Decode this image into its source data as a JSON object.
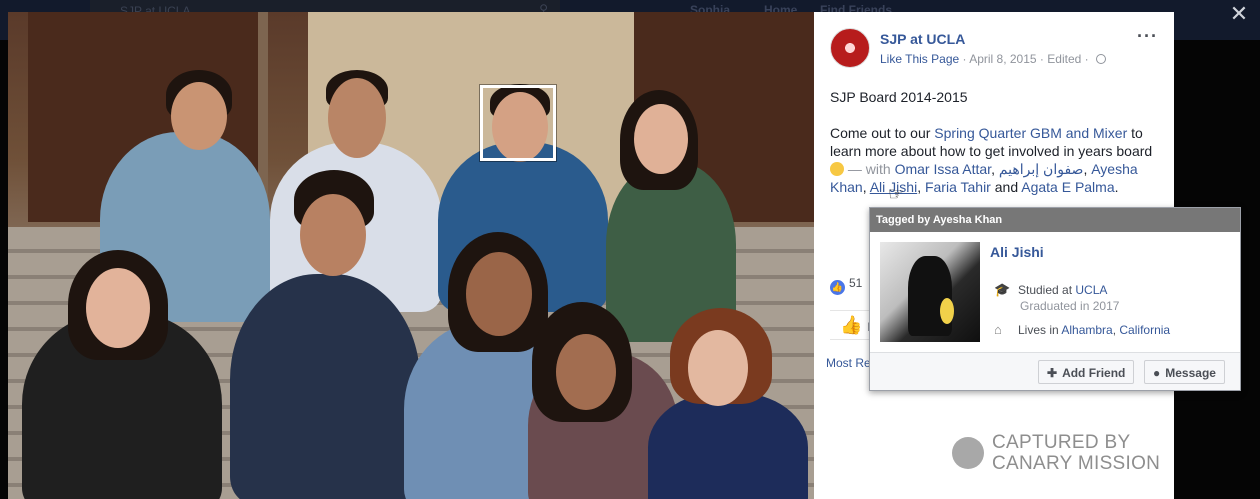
{
  "topbar": {
    "search_text": "SJP at UCLA",
    "nav_items": [
      "Sophia",
      "Home",
      "Find Friends"
    ]
  },
  "photo": {
    "tagged_face": "Ali Jishi"
  },
  "post": {
    "page_name": "SJP at UCLA",
    "like_page": "Like This Page",
    "date": "April 8, 2015",
    "edited": "Edited",
    "board_line": "SJP Board 2014-2015",
    "text_1": "Come out to our ",
    "event_link": "Spring Quarter GBM and Mixer",
    "text_2": " to",
    "text_3": "learn more about how to get involved in years board",
    "with_label": " — with ",
    "tag_1": "Omar Issa Attar",
    "tag_2": "صفوان إبراهيم",
    "tag_3a": "Ayesha",
    "tag_3b": "Khan",
    "tag_4": "Ali Jishi",
    "tag_5": "Faria Tahir",
    "and_label": " and ",
    "tag_6": "Agata E Palma",
    "reaction_count": "51",
    "like_label": "L",
    "most_relevant": "Most Re"
  },
  "watermark": {
    "line1": "CAPTURED BY",
    "line2": "CANARY MISSION"
  },
  "hovercard": {
    "header": "Tagged by Ayesha Khan",
    "name": "Ali Jishi",
    "studied_label": "Studied at ",
    "school": "UCLA",
    "graduated": "Graduated in 2017",
    "lives_label": "Lives in ",
    "city": "Alhambra",
    "state": "California",
    "add_friend": "Add Friend",
    "message": "Message"
  },
  "colors": {
    "link": "#365899",
    "muted": "#90949c",
    "hovercard_header": "#777777"
  }
}
